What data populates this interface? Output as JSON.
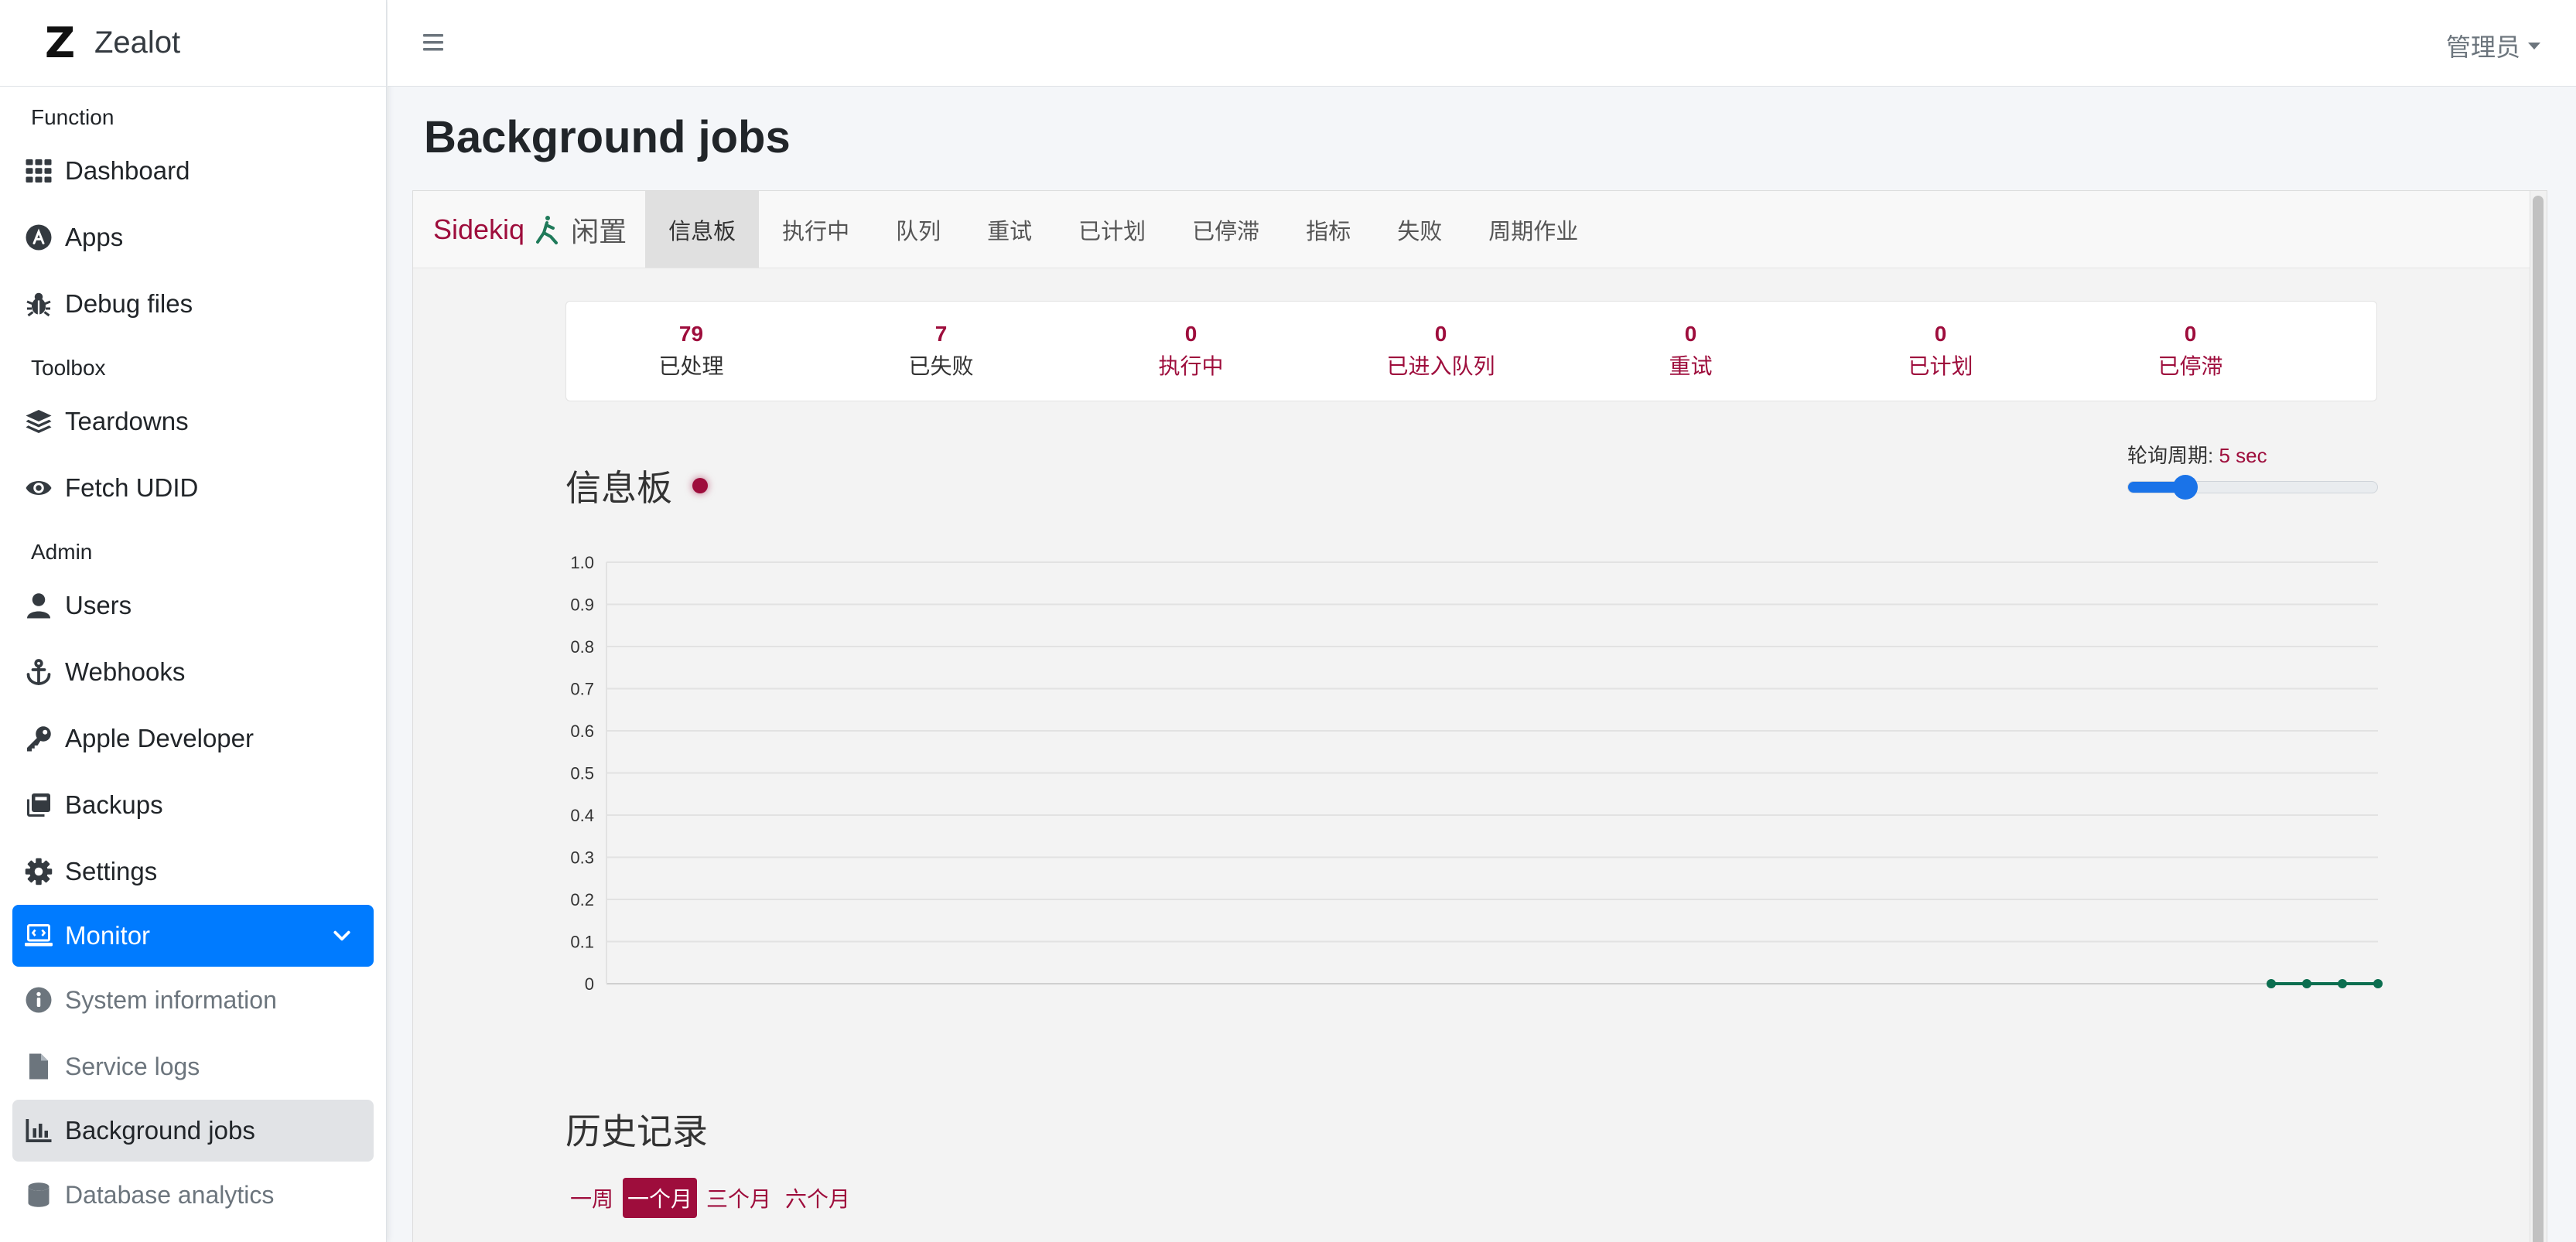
{
  "brand": {
    "name": "Zealot",
    "logo_letter": "Z"
  },
  "sidebar": {
    "sections": [
      {
        "title": "Function",
        "items": [
          {
            "label": "Dashboard",
            "icon": "grid-icon"
          },
          {
            "label": "Apps",
            "icon": "app-store-icon"
          },
          {
            "label": "Debug files",
            "icon": "bug-icon"
          }
        ]
      },
      {
        "title": "Toolbox",
        "items": [
          {
            "label": "Teardowns",
            "icon": "layers-icon"
          },
          {
            "label": "Fetch UDID",
            "icon": "eye-icon"
          }
        ]
      },
      {
        "title": "Admin",
        "items": [
          {
            "label": "Users",
            "icon": "user-icon"
          },
          {
            "label": "Webhooks",
            "icon": "anchor-icon"
          },
          {
            "label": "Apple Developer",
            "icon": "key-icon"
          },
          {
            "label": "Backups",
            "icon": "backup-icon"
          },
          {
            "label": "Settings",
            "icon": "gear-icon"
          }
        ]
      }
    ],
    "monitor": {
      "label": "Monitor",
      "icon": "monitor-icon"
    },
    "monitor_items": [
      {
        "label": "System information",
        "icon": "info-icon"
      },
      {
        "label": "Service logs",
        "icon": "file-icon"
      },
      {
        "label": "Background jobs",
        "icon": "chart-bar-icon"
      },
      {
        "label": "Database analytics",
        "icon": "database-icon"
      }
    ]
  },
  "header": {
    "user_menu": "管理员"
  },
  "page": {
    "title": "Background jobs"
  },
  "sidekiq": {
    "brand": "Sidekiq",
    "status": "闲置",
    "tabs": [
      "信息板",
      "执行中",
      "队列",
      "重试",
      "已计划",
      "已停滞",
      "指标",
      "失败",
      "周期作业"
    ],
    "active_tab": "信息板",
    "stats": [
      {
        "count": "79",
        "label": "已处理",
        "link": false
      },
      {
        "count": "7",
        "label": "已失败",
        "link": false
      },
      {
        "count": "0",
        "label": "执行中",
        "link": true
      },
      {
        "count": "0",
        "label": "已进入队列",
        "link": true
      },
      {
        "count": "0",
        "label": "重试",
        "link": true
      },
      {
        "count": "0",
        "label": "已计划",
        "link": true
      },
      {
        "count": "0",
        "label": "已停滞",
        "link": true
      }
    ],
    "dashboard_heading": "信息板",
    "poll": {
      "label": "轮询周期:",
      "value": "5 sec",
      "level_fraction": 0.2
    },
    "history_heading": "历史记录",
    "ranges": [
      "一周",
      "一个月",
      "三个月",
      "六个月"
    ],
    "active_range": "一个月",
    "colors": {
      "accent": "#9e0d3c",
      "line": "#0b6e4f",
      "primary": "#007bff"
    }
  },
  "chart_data": {
    "type": "line",
    "title": "",
    "xlabel": "",
    "ylabel": "",
    "ylim": [
      0,
      1.0
    ],
    "yticks": [
      "1.0",
      "0.9",
      "0.8",
      "0.7",
      "0.6",
      "0.5",
      "0.4",
      "0.3",
      "0.2",
      "0.1",
      "0"
    ],
    "grid": true,
    "series": [
      {
        "values": [
          0,
          0,
          0,
          0
        ]
      }
    ]
  }
}
